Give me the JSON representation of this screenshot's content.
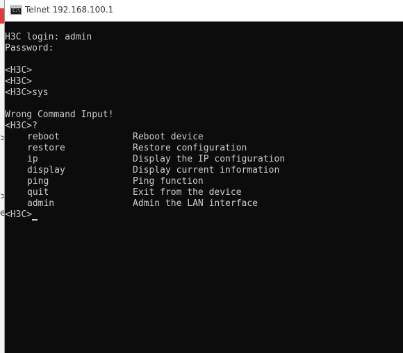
{
  "window": {
    "title": "Telnet 192.168.100.1",
    "app_icon": "console-icon",
    "app_icon_text": "C:\\"
  },
  "behind_window": {
    "glyphs": [
      ">",
      ">",
      "e"
    ]
  },
  "terminal": {
    "login_line": "H3C login: admin",
    "password_line": "Password:",
    "blank": "",
    "prompt_lines": [
      "<H3C>",
      "<H3C>",
      "<H3C>sys"
    ],
    "error_line": "Wrong Command Input!",
    "help_prompt": "<H3C>?",
    "help": [
      {
        "command": "reboot",
        "description": "Reboot device"
      },
      {
        "command": "restore",
        "description": "Restore configuration"
      },
      {
        "command": "ip",
        "description": "Display the IP configuration"
      },
      {
        "command": "display",
        "description": "Display current information"
      },
      {
        "command": "ping",
        "description": "Ping function"
      },
      {
        "command": "quit",
        "description": "Exit from the device"
      },
      {
        "command": "admin",
        "description": "Admin the LAN interface"
      }
    ],
    "final_prompt": "<H3C>"
  },
  "colors": {
    "terminal_bg": "#0c0c0c",
    "terminal_fg": "#cccccc",
    "titlebar_bg": "#ffffff"
  }
}
